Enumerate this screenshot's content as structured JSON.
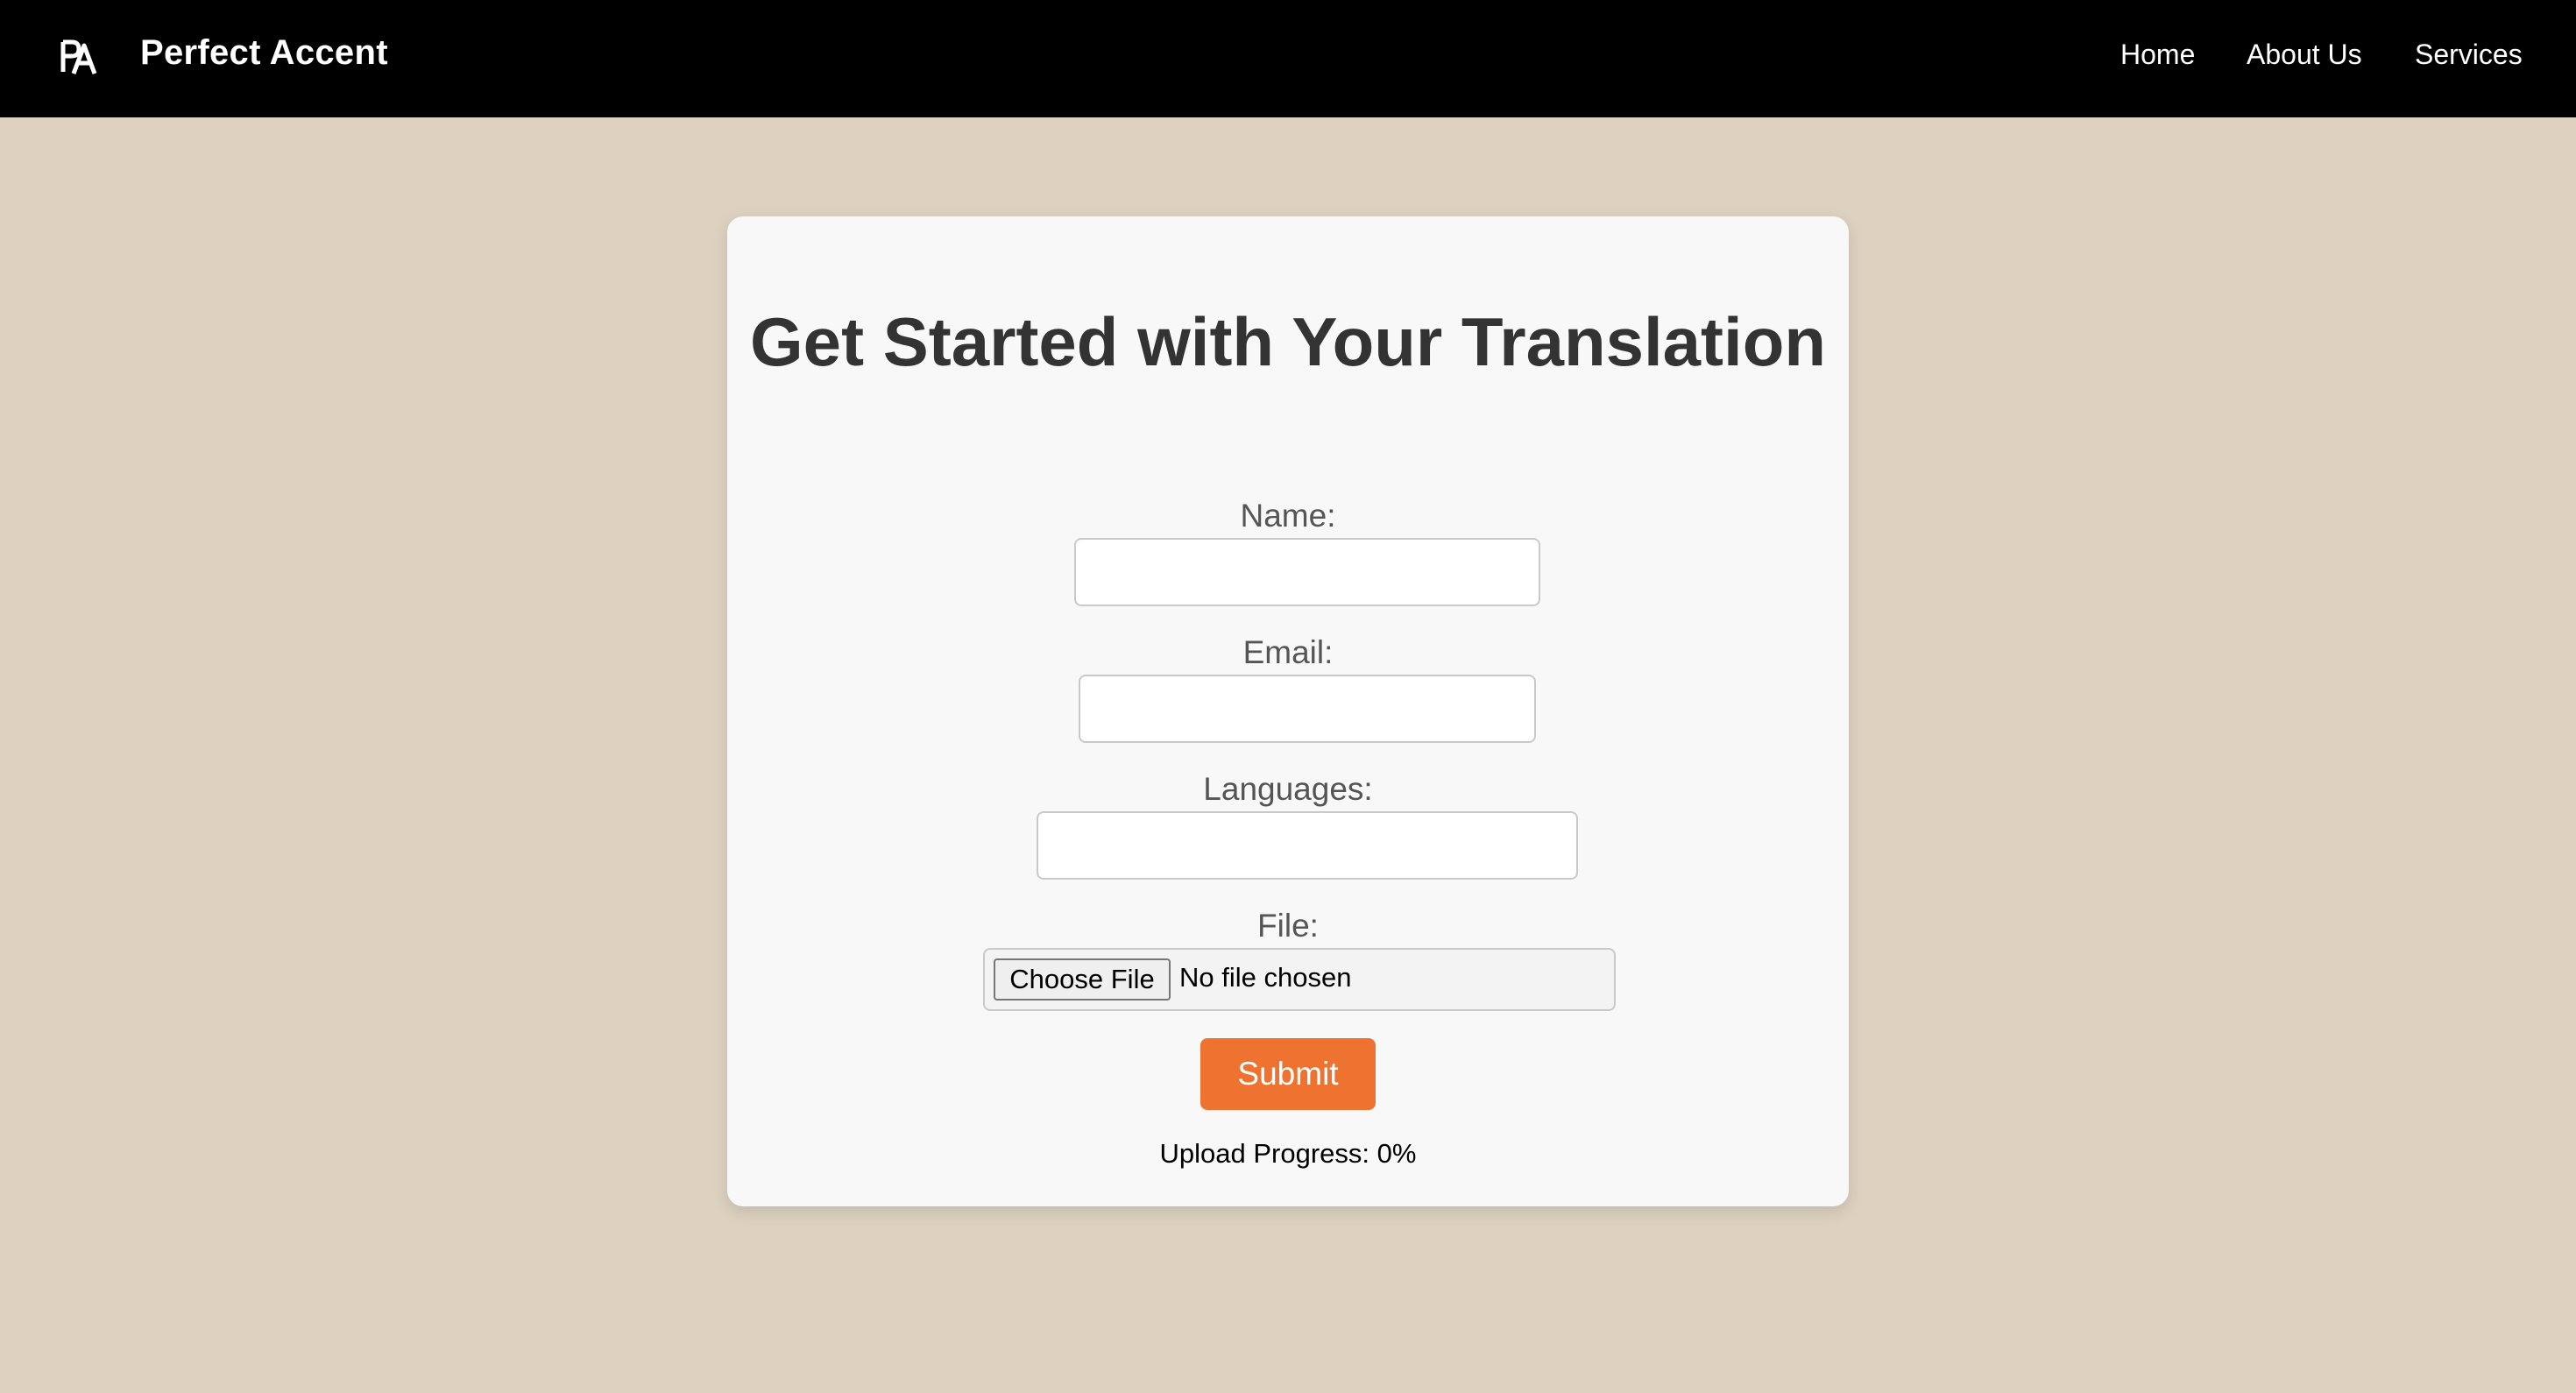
{
  "header": {
    "logo_text": "PA",
    "brand": "Perfect Accent",
    "nav": [
      {
        "label": "Home"
      },
      {
        "label": "About Us"
      },
      {
        "label": "Services"
      }
    ]
  },
  "form": {
    "title": "Get Started with Your Translation",
    "name_label": "Name:",
    "name_value": "",
    "email_label": "Email:",
    "email_value": "",
    "languages_label": "Languages:",
    "languages_value": "",
    "file_label": "File:",
    "choose_file_label": "Choose File",
    "file_status": "No file chosen",
    "submit_label": "Submit",
    "progress_text": "Upload Progress: 0%",
    "upload_progress_percent": 0
  },
  "colors": {
    "page_background": "#ddd2c0",
    "header_background": "#000000",
    "card_background": "#f8f8f8",
    "accent": "#ee7330",
    "title_text": "#333333"
  },
  "icons": {
    "logo": "pa-monogram-icon"
  }
}
